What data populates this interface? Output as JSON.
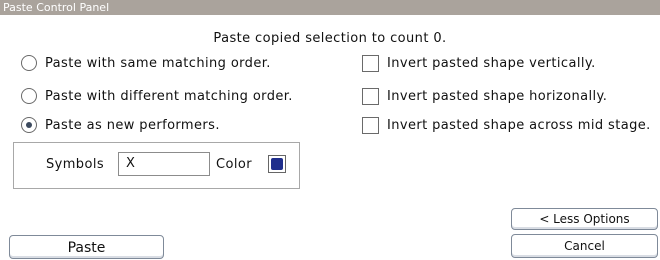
{
  "window": {
    "title": "Paste Control Panel"
  },
  "info_text": "Paste copied selection to count 0.",
  "options": {
    "radios": [
      {
        "label": "Paste with same matching order.",
        "selected": false
      },
      {
        "label": "Paste with different matching order.",
        "selected": false
      },
      {
        "label": "Paste as new performers.",
        "selected": true
      }
    ],
    "checkboxes": [
      {
        "label": "Invert pasted shape vertically.",
        "checked": false
      },
      {
        "label": "Invert pasted shape horizonally.",
        "checked": false
      },
      {
        "label": "Invert pasted shape across mid stage.",
        "checked": false
      }
    ]
  },
  "symbols": {
    "label": "Symbols",
    "value": "X",
    "color_label": "Color",
    "color": "#1f2e8c"
  },
  "buttons": {
    "paste": "Paste",
    "less_options": "< Less Options",
    "cancel": "Cancel"
  }
}
